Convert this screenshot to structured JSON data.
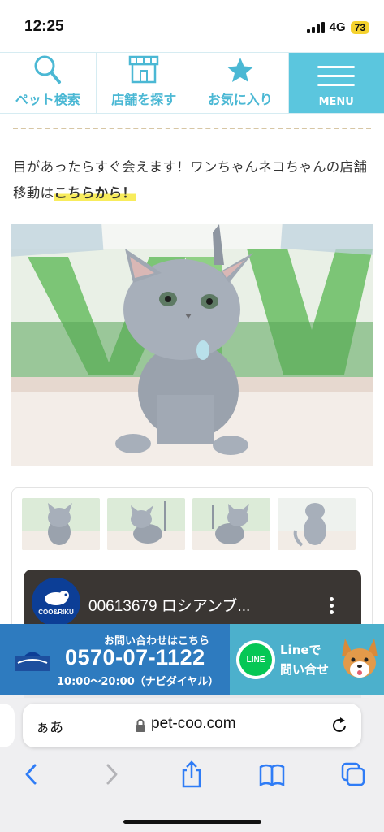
{
  "status_bar": {
    "time": "12:25",
    "network": "4G",
    "battery": "73"
  },
  "nav": {
    "items": [
      {
        "label": "ペット検索",
        "icon": "magnifier-icon"
      },
      {
        "label": "店舗を探す",
        "icon": "store-icon"
      },
      {
        "label": "お気に入り",
        "icon": "star-icon"
      }
    ],
    "menu_label": "MENU"
  },
  "intro": {
    "text": "目があったらすぐ会えます！ワンちゃんネコちゃんの店舗移動は",
    "link": "こちらから！"
  },
  "video": {
    "title": "00613679 ロシアンブ...",
    "logo_text": "COO&RIKU"
  },
  "contact": {
    "lead": "お問い合わせはこちら",
    "phone": "0570-07-1122",
    "hours": "10:00〜20:00（ナビダイヤル）",
    "line_badge": "LINE",
    "line_text_1": "Lineで",
    "line_text_2": "問い合せ"
  },
  "browser": {
    "aa": "ぁあ",
    "host": "pet-coo.com"
  },
  "colors": {
    "accent": "#5bc6de",
    "phone_bg": "#2e7bbf",
    "line_green": "#06c755"
  }
}
